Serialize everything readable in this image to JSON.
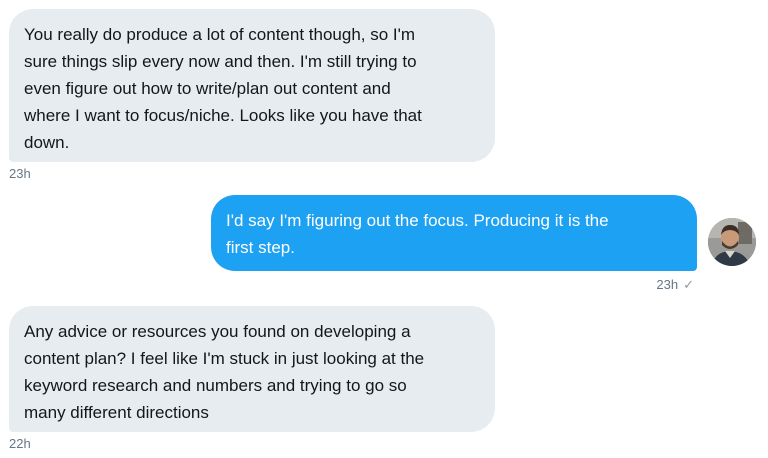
{
  "messages": [
    {
      "direction": "incoming",
      "text": "You really do produce a lot of content though, so I'm\nsure things slip every now and then. I'm still trying to\neven figure out how to write/plan out content and\nwhere I want to focus/niche. Looks like you have that\ndown.",
      "time": "23h"
    },
    {
      "direction": "outgoing",
      "text": "I'd say I'm figuring out the focus. Producing it is the\nfirst step.",
      "time": "23h",
      "status_icon": "check-icon"
    },
    {
      "direction": "incoming",
      "text": "Any advice or resources you found on developing a\ncontent plan? I feel like I'm stuck in just looking at the\nkeyword research and numbers and trying to go so\nmany different directions",
      "time": "22h"
    }
  ],
  "colors": {
    "incoming_bubble": "#e6ecf0",
    "outgoing_bubble": "#1da1f2",
    "timestamp": "#657786"
  },
  "icons": {
    "check": "✓"
  }
}
